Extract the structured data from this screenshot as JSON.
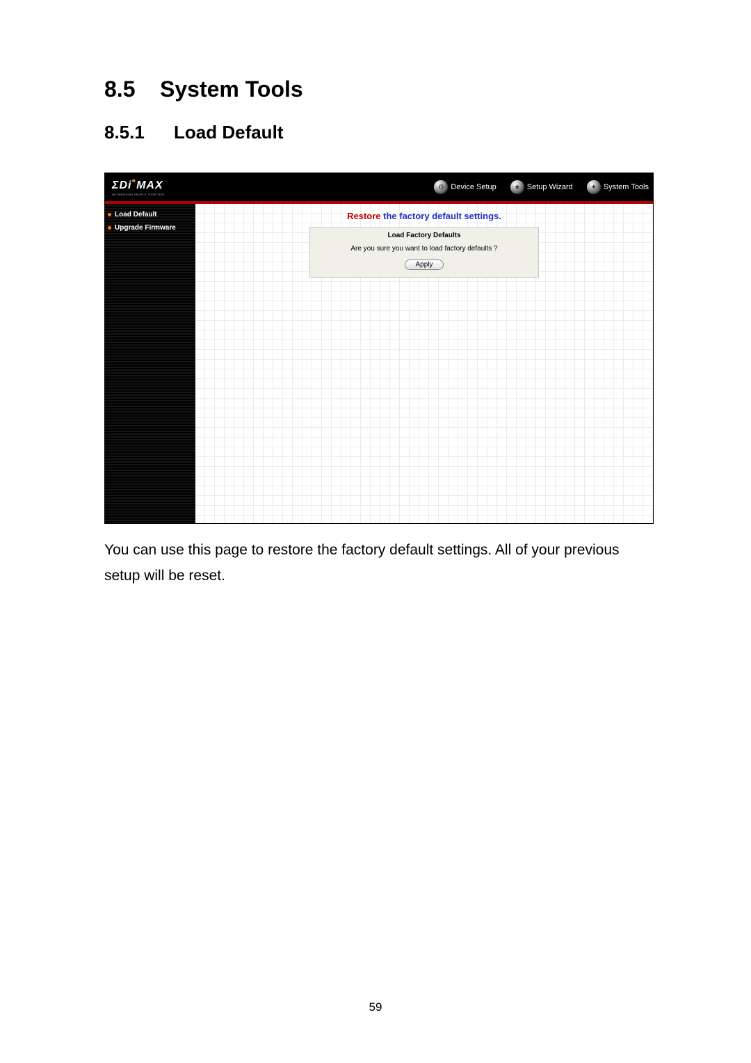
{
  "section": {
    "number": "8.5",
    "title": "System Tools"
  },
  "subsection": {
    "number": "8.5.1",
    "title": "Load Default"
  },
  "logo": {
    "main_prefix": "ΣDi",
    "main_suffix": "MAX",
    "tagline": "NETWORKING PEOPLE TOGETHER"
  },
  "topnav": {
    "device_setup": "Device Setup",
    "setup_wizard": "Setup Wizard",
    "system_tools": "System Tools",
    "icon_glyph_device": "⚙",
    "icon_glyph_wizard": "★",
    "icon_glyph_tools": "✦"
  },
  "sidebar": {
    "load_default": "Load Default",
    "upgrade_firmware": "Upgrade Firmware"
  },
  "content": {
    "restore_prefix": "Restore ",
    "restore_rest": "the factory default settings.",
    "panel_title": "Load Factory Defaults",
    "panel_question": "Are you sure you want to load factory defaults ?",
    "apply": "Apply"
  },
  "caption": "You can use this page to restore the factory default settings. All of your previous setup will be reset.",
  "page_number": "59"
}
